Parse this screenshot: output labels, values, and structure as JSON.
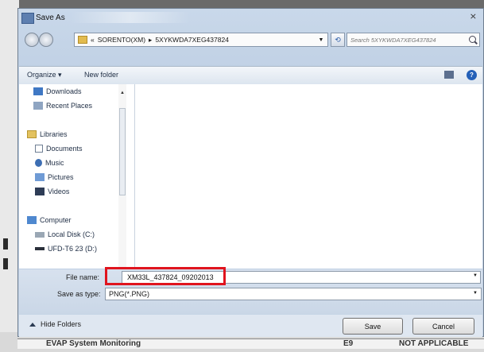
{
  "window": {
    "title": "Save As",
    "close_glyph": "⨯"
  },
  "address": {
    "path_prefix": "«",
    "segment1": "SORENTO(XM)",
    "separator": "▸",
    "segment2": "5XYKWDA7XEG437824"
  },
  "search": {
    "placeholder": "Search 5XYKWDA7XEG437824"
  },
  "toolbar": {
    "organize": "Organize ▾",
    "new_folder": "New folder"
  },
  "nav": {
    "downloads": "Downloads",
    "recent_places": "Recent Places",
    "libraries": "Libraries",
    "documents": "Documents",
    "music": "Music",
    "pictures": "Pictures",
    "videos": "Videos",
    "computer": "Computer",
    "local_disk": "Local Disk (C:)",
    "usb": "UFD-T6 23 (D:)"
  },
  "form": {
    "file_name_label": "File name:",
    "file_name_value": "XM33L_437824_09202013",
    "save_as_type_label": "Save as type:",
    "save_as_type_value": "PNG(*.PNG)"
  },
  "footer": {
    "hide_folders": "Hide Folders",
    "save": "Save",
    "cancel": "Cancel"
  },
  "background": {
    "row_left": "EVAP System Monitoring",
    "row_mid": "E9",
    "row_right": "NOT APPLICABLE"
  },
  "colors": {
    "highlight_box": "#e0141e",
    "help": "#2460b8"
  }
}
